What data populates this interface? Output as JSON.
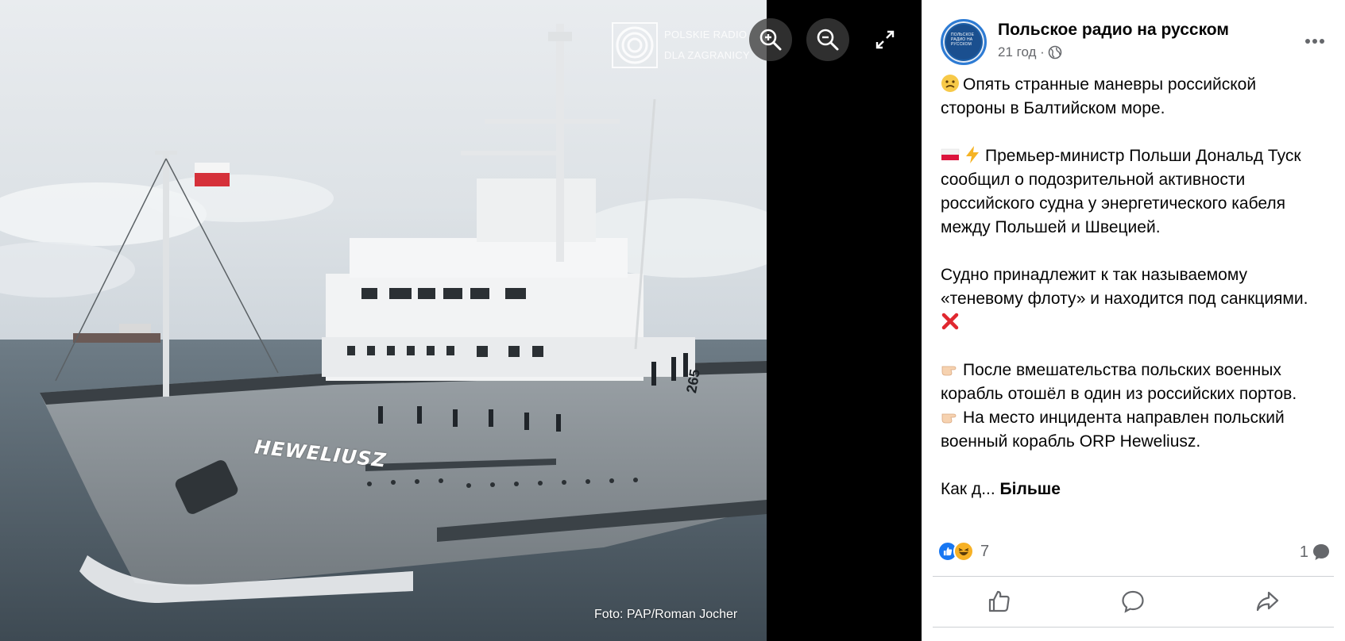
{
  "viewer": {
    "watermark": {
      "line1": "POLSKIE RADIO",
      "line2": "DLA ZAGRANICY"
    },
    "photo_credit": "Foto: PAP/Roman Jocher",
    "ship_name": "HEWELIUSZ",
    "hull_number": "265",
    "zoom_in_icon": "zoom-in-icon",
    "zoom_out_icon": "zoom-out-icon",
    "fullscreen_icon": "expand-icon"
  },
  "post": {
    "page_name": "Польское радио на русском",
    "time": "21 год ·",
    "privacy_icon": "globe-icon",
    "more_icon": "ellipsis-icon",
    "avatar_text": "ПОЛЬСКОЕ РАДИО НА РУССКОМ",
    "paragraphs": {
      "p1": {
        "emoji": "worried-face",
        "l1": "Опять странные маневры российской",
        "l2": "стороны в Балтийском море."
      },
      "p2": {
        "emoji1": "poland-flag",
        "emoji2": "lightning",
        "l1": "Премьер-министр Польши Дональд Туск",
        "l2": "сообщил о подозрительной активности",
        "l3": "российского судна у энергетического кабеля",
        "l4": "между Польшей и Швецией."
      },
      "p3": {
        "l1": "Судно принадлежит к так называемому",
        "l2": "«теневому флоту» и находится под санкциями.",
        "emoji": "cross-mark"
      },
      "p4": {
        "emoji": "pointing-hand",
        "l1": "После вмешательства польских военных",
        "l2": "корабль отошёл в один из российских портов.",
        "l3": "На место инцидента направлен польский",
        "l4": "военный корабль ORP Heweliusz."
      },
      "p5": {
        "text": "Как д...",
        "see_more": "Більше"
      }
    },
    "reactions": {
      "count": "7",
      "icons": [
        "like-icon",
        "haha-icon"
      ]
    },
    "comments": {
      "count": "1",
      "icon": "comment-bubble-icon"
    },
    "actions": [
      "like-icon",
      "comment-icon",
      "share-icon"
    ]
  },
  "colors": {
    "accent": "#1877f2",
    "secondary_text": "#65676b",
    "divider": "#ced0d4"
  }
}
